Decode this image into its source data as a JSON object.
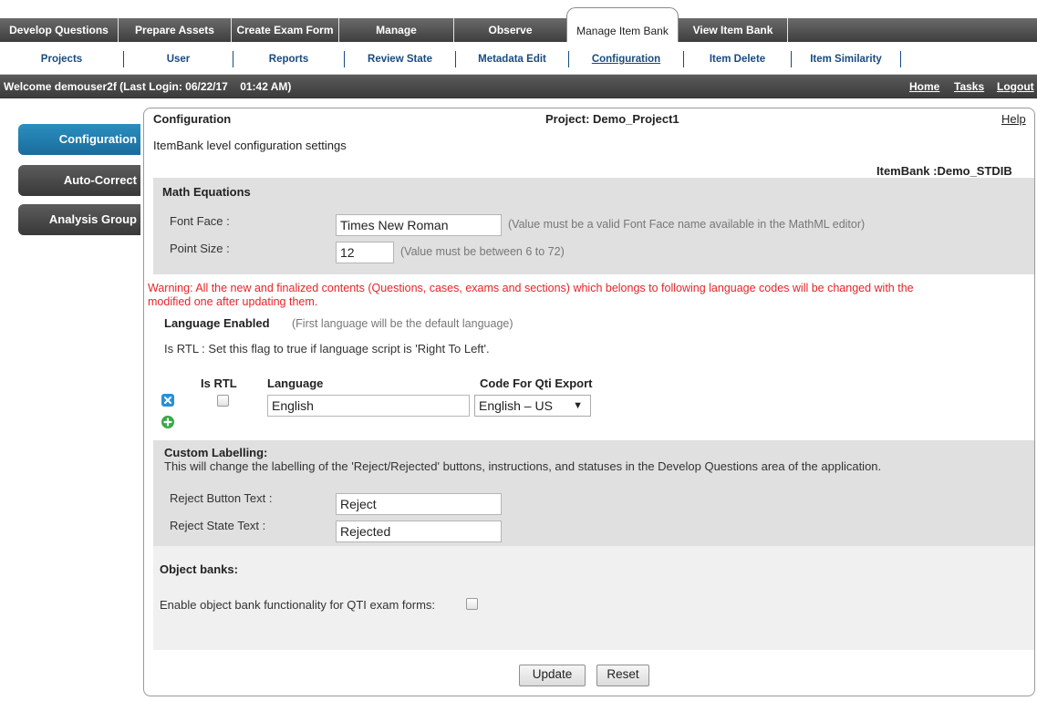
{
  "top_nav": {
    "tabs": [
      "Develop Questions",
      "Prepare Assets",
      "Create Exam Form",
      "Manage",
      "Observe",
      "Manage Item Bank",
      "View Item Bank"
    ],
    "active": "Manage Item Bank"
  },
  "sub_nav": {
    "tabs": [
      "Projects",
      "User",
      "Reports",
      "Review State",
      "Metadata Edit",
      "Configuration",
      "Item Delete",
      "Item Similarity"
    ],
    "active": "Configuration"
  },
  "welcome": {
    "text": "Welcome demouser2f (Last Login: 06/22/17    01:42 AM)",
    "links": [
      "Home",
      "Tasks",
      "Logout"
    ]
  },
  "side_menu": {
    "items": [
      "Configuration",
      "Auto-Correct",
      "Analysis Group"
    ],
    "active": "Configuration"
  },
  "panel": {
    "title": "Configuration",
    "project": "Project: Demo_Project1",
    "help": "Help",
    "subtitle": "ItemBank level configuration settings",
    "itembank": "ItemBank :Demo_STDIB"
  },
  "math": {
    "heading": "Math Equations",
    "font_face_label": "Font Face :",
    "font_face_value": "Times New Roman",
    "font_face_hint": "(Value must be a valid Font Face name available in the MathML editor)",
    "point_size_label": "Point Size :",
    "point_size_value": "12",
    "point_size_hint": "(Value must be between 6 to 72)"
  },
  "language": {
    "warning_line1": "Warning: All the new and finalized contents (Questions, cases, exams and sections) which belongs to following language codes will be changed with the",
    "warning_line2": "modified one after updating them.",
    "enabled_label": "Language Enabled",
    "enabled_hint": "(First language will be the default language)",
    "rtl_note": "Is RTL : Set this flag to true if language script is 'Right To Left'.",
    "col_rtl": "Is RTL",
    "col_language": "Language",
    "col_code": "Code For Qti Export",
    "row_language": "English",
    "row_code": "English – US",
    "row_rtl_checked": false
  },
  "custom": {
    "heading": "Custom Labelling:",
    "desc": "This will change the labelling of the 'Reject/Rejected' buttons, instructions, and statuses in the Develop Questions area of the application.",
    "reject_button_label": "Reject Button Text :",
    "reject_button_value": "Reject",
    "reject_state_label": "Reject State Text :",
    "reject_state_value": "Rejected"
  },
  "object_banks": {
    "heading": "Object banks:",
    "enable_label": "Enable object bank functionality for QTI exam forms:",
    "enabled": false
  },
  "actions": {
    "update": "Update",
    "reset": "Reset"
  },
  "colors": {
    "accent": "#1a6d9c",
    "warning": "#e8242a",
    "nav_dark": "#3e3e3e",
    "link_blue": "#1a4b80",
    "add_green": "#3aa847",
    "delete_blue": "#2a8fd6"
  }
}
